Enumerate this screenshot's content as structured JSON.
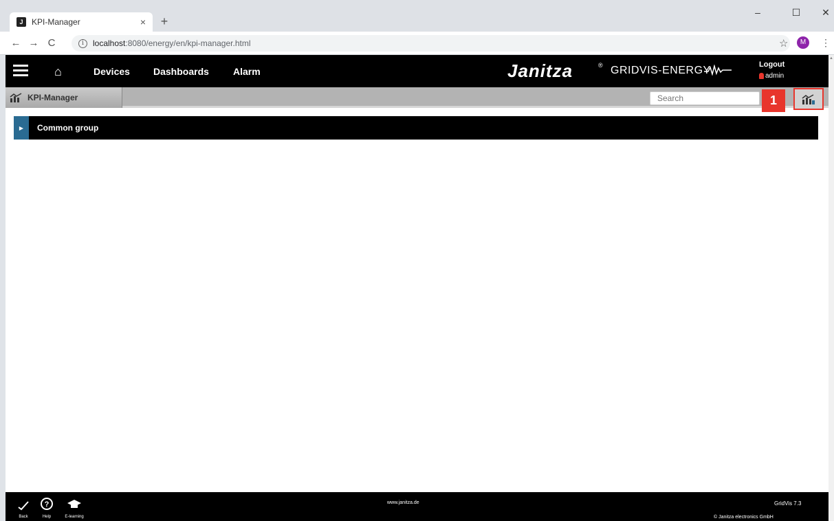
{
  "browser": {
    "tab_title": "KPI-Manager",
    "tab_close": "×",
    "new_tab": "+",
    "favicon": "J",
    "url_host": "localhost",
    "url_rest": ":8080/energy/en/kpi-manager.html",
    "profile_initial": "M"
  },
  "nav": {
    "devices": "Devices",
    "dashboards": "Dashboards",
    "alarm": "Alarm"
  },
  "brand": {
    "name": "Janitza",
    "registered": "®",
    "product": "GRIDVIS-ENERGY"
  },
  "user": {
    "logout": "Logout",
    "name": "admin"
  },
  "subbar": {
    "tab_label": "KPI-Manager",
    "search_placeholder": "Search"
  },
  "marker": {
    "number": "1",
    "color": "#e8352c"
  },
  "groups": [
    {
      "label": "Common group",
      "expanded": false
    }
  ],
  "footer": {
    "back": "Back",
    "help": "Help",
    "elearning": "E-learning",
    "url": "www.janitza.de",
    "version": "GridVis 7.3",
    "copyright": "© Janitza electronics GmbH"
  },
  "colors": {
    "accent_blue": "#2a6b92",
    "header": "#000000",
    "subbar": "#b3b3b3"
  }
}
